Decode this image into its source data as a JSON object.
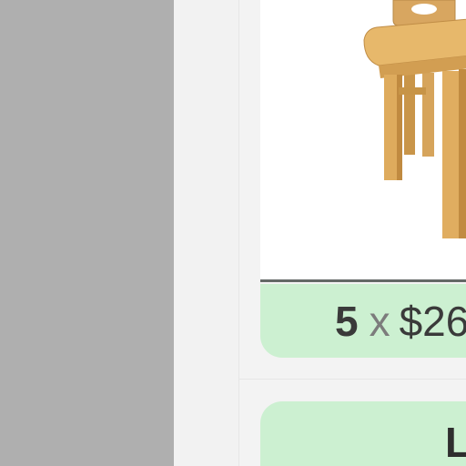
{
  "product": {
    "image_icon": "wooden-table-and-chair-image",
    "quantity": "5",
    "times": "x",
    "price": "$26"
  },
  "next_item": {
    "label_partial": "L"
  },
  "colors": {
    "left_panel": "#afafaf",
    "background": "#f3f3f3",
    "pill": "#ccf0d1",
    "card_bar": "#636966"
  }
}
